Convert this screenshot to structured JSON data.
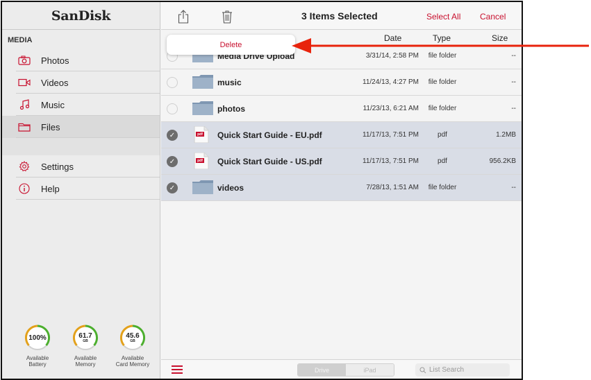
{
  "sidebar": {
    "logo": "SanDisk",
    "section": "MEDIA",
    "items": [
      {
        "label": "Photos",
        "icon": "camera-icon"
      },
      {
        "label": "Videos",
        "icon": "video-icon"
      },
      {
        "label": "Music",
        "icon": "music-icon"
      },
      {
        "label": "Files",
        "icon": "folder-icon"
      }
    ],
    "settings": {
      "label": "Settings",
      "icon": "gear-icon"
    },
    "help": {
      "label": "Help",
      "icon": "info-icon"
    },
    "gauges": [
      {
        "value": "100%",
        "unit": "",
        "caption1": "Available",
        "caption2": "Battery"
      },
      {
        "value": "61.7",
        "unit": "GB",
        "caption1": "Available",
        "caption2": "Memory"
      },
      {
        "value": "45.6",
        "unit": "GB",
        "caption1": "Available",
        "caption2": "Card Memory"
      }
    ]
  },
  "toolbar": {
    "title": "3 Items Selected",
    "select_all": "Select All",
    "cancel": "Cancel"
  },
  "popover": {
    "delete": "Delete"
  },
  "columns": {
    "date": "Date",
    "type": "Type",
    "size": "Size"
  },
  "files": [
    {
      "name": "Media Drive Upload",
      "date": "3/31/14, 2:58 PM",
      "type": "file folder",
      "size": "--",
      "kind": "folder",
      "selected": false
    },
    {
      "name": "music",
      "date": "11/24/13, 4:27 PM",
      "type": "file folder",
      "size": "--",
      "kind": "folder",
      "selected": false
    },
    {
      "name": "photos",
      "date": "11/23/13, 6:21 AM",
      "type": "file folder",
      "size": "--",
      "kind": "folder",
      "selected": false
    },
    {
      "name": "Quick Start Guide - EU.pdf",
      "date": "11/17/13, 7:51 PM",
      "type": "pdf",
      "size": "1.2MB",
      "kind": "pdf",
      "selected": true
    },
    {
      "name": "Quick Start Guide - US.pdf",
      "date": "11/17/13, 7:51 PM",
      "type": "pdf",
      "size": "956.2KB",
      "kind": "pdf",
      "selected": true
    },
    {
      "name": "videos",
      "date": "7/28/13, 1:51 AM",
      "type": "file folder",
      "size": "--",
      "kind": "folder",
      "selected": true
    }
  ],
  "pdf_badge": "pdf",
  "bottombar": {
    "seg_drive": "Drive",
    "seg_ipad": "iPad",
    "search_placeholder": "List Search"
  },
  "colors": {
    "accent": "#c8102e",
    "selected_row": "#d9dde6",
    "arrow": "#e8230c"
  }
}
